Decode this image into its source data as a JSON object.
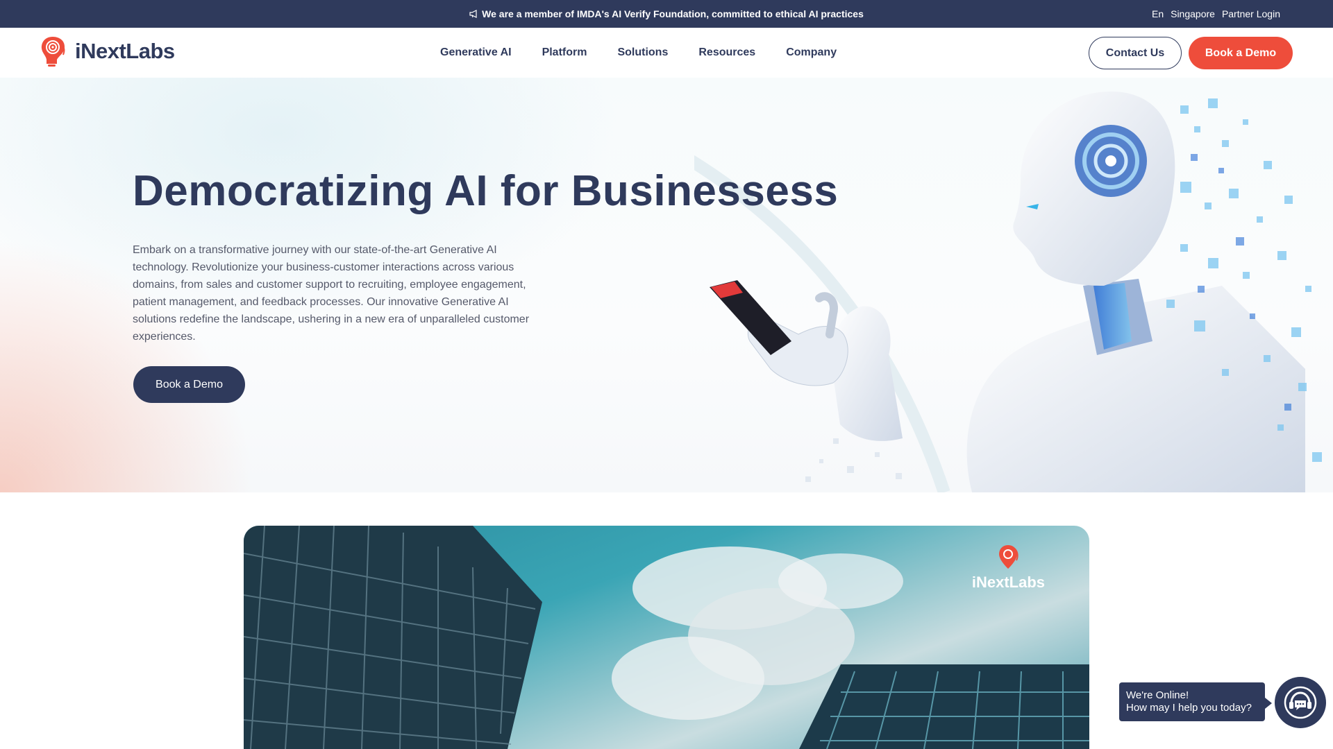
{
  "announcement": {
    "text": "We are a member of IMDA's AI Verify Foundation, committed to ethical AI practices",
    "icon": "megaphone-icon"
  },
  "top_nav": {
    "language": "En",
    "region": "Singapore",
    "partner_login": "Partner Login"
  },
  "brand": {
    "name": "iNextLabs",
    "primary_color": "#2f3a5c",
    "accent_color": "#ee4d3b"
  },
  "main_nav": [
    "Generative AI",
    "Platform",
    "Solutions",
    "Resources",
    "Company"
  ],
  "header_buttons": {
    "contact": "Contact Us",
    "demo": "Book a Demo"
  },
  "hero": {
    "title": "Democratizing AI for Businessess",
    "description": "Embark on a transformative journey with our state-of-the-art Generative AI technology. Revolutionize your business-customer interactions across various domains, from sales and customer support to recruiting, employee engagement, patient management, and feedback processes. Our innovative Generative AI solutions redefine the landscape, ushering in a new era of unparalleled customer experiences.",
    "cta": "Book a Demo"
  },
  "video": {
    "logo_text": "iNextLabs"
  },
  "chat": {
    "line1": "We're Online!",
    "line2": "How may I help you today?",
    "icon": "chat-support-icon"
  }
}
